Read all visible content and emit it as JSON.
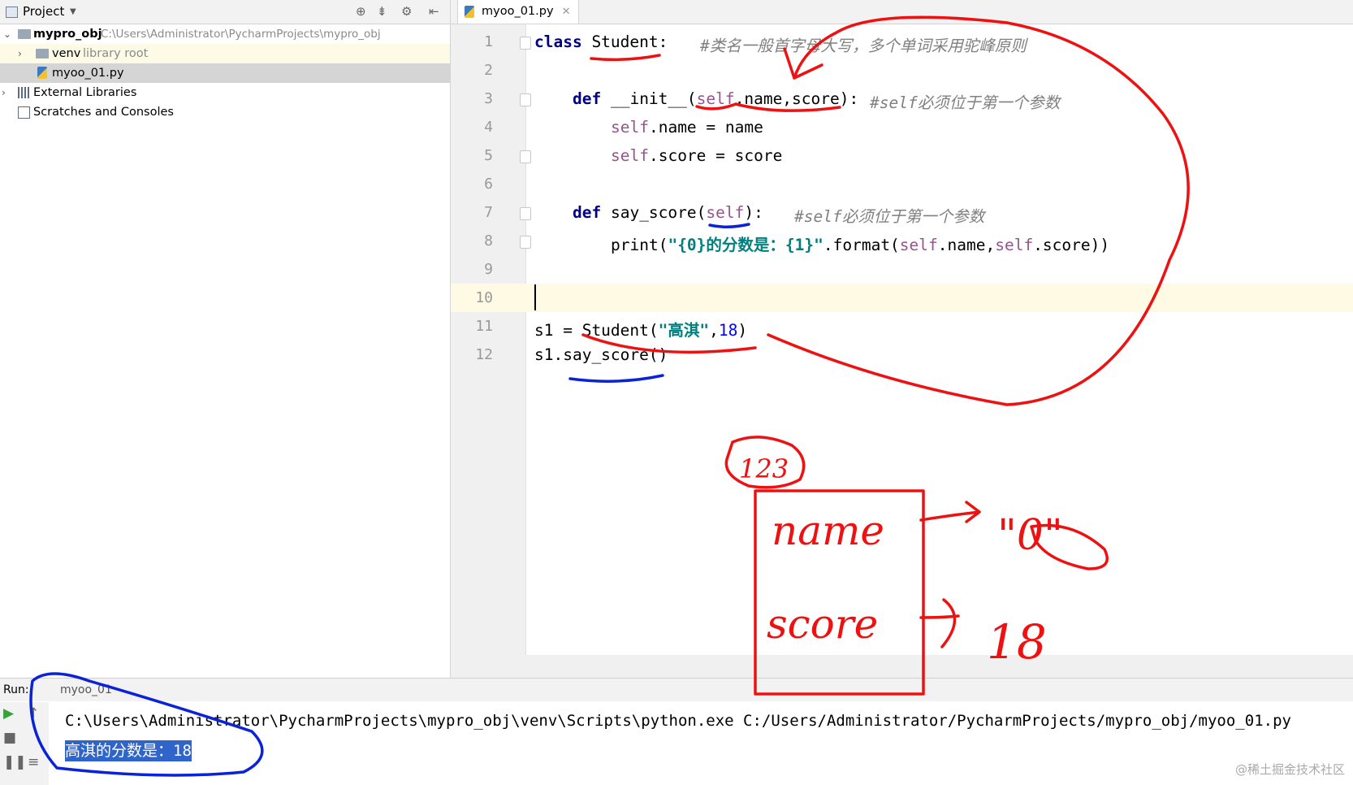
{
  "project": {
    "title": "Project",
    "root": {
      "name": "mypro_obj",
      "path": "C:\\Users\\Administrator\\PycharmProjects\\mypro_obj"
    },
    "venv": {
      "name": "venv",
      "note": "library root"
    },
    "file": "myoo_01.py",
    "external_libraries": "External Libraries",
    "scratches": "Scratches and Consoles"
  },
  "editor": {
    "tab_label": "myoo_01.py",
    "line_numbers": [
      "1",
      "2",
      "3",
      "4",
      "5",
      "6",
      "7",
      "8",
      "9",
      "10",
      "11",
      "12"
    ],
    "lines": {
      "l1_kw": "class",
      "l1_rest": " Student:",
      "l1_comment": "#类名一般首字母大写，多个单词采用驼峰原则",
      "l3_kw": "def",
      "l3_name": " __init__(",
      "l3_self": "self",
      "l3_rest": ",name,score):",
      "l3_comment": "#self必须位于第一个参数",
      "l4_self": "self",
      "l4_rest": ".name = name",
      "l5_self": "self",
      "l5_rest": ".score = score",
      "l7_kw": "def",
      "l7_name": " say_score(",
      "l7_self": "self",
      "l7_rest": "):",
      "l7_comment": "#self必须位于第一个参数",
      "l8_print": "print(",
      "l8_str": "\"{0}的分数是：{1}\"",
      "l8_fmt": ".format(",
      "l8_self1": "self",
      "l8_mid": ".name,",
      "l8_self2": "self",
      "l8_end": ".score))",
      "l11_pre": "s1 = Student(",
      "l11_str": "\"高淇\"",
      "l11_comma": ",",
      "l11_num": "18",
      "l11_end": ")",
      "l12": "s1.say_score()"
    }
  },
  "run": {
    "label": "Run:",
    "tab": "myoo_01",
    "command": "C:\\Users\\Administrator\\PycharmProjects\\mypro_obj\\venv\\Scripts\\python.exe C:/Users/Administrator/PycharmProjects/mypro_obj/myoo_01.py",
    "output": "高淇的分数是：18"
  },
  "annotations": {
    "circled": "123",
    "box_name": "name",
    "box_score": "score",
    "name_value": "\"0\"",
    "score_value": "18"
  },
  "watermark": "@稀土掘金技术社区",
  "colors": {
    "keyword": "#000080",
    "self": "#94558d",
    "string": "#008080",
    "number": "#0000ff",
    "comment": "#808080",
    "annotation_red": "#ee1111",
    "annotation_blue": "#0a22d8",
    "selection": "#2f65ca"
  }
}
